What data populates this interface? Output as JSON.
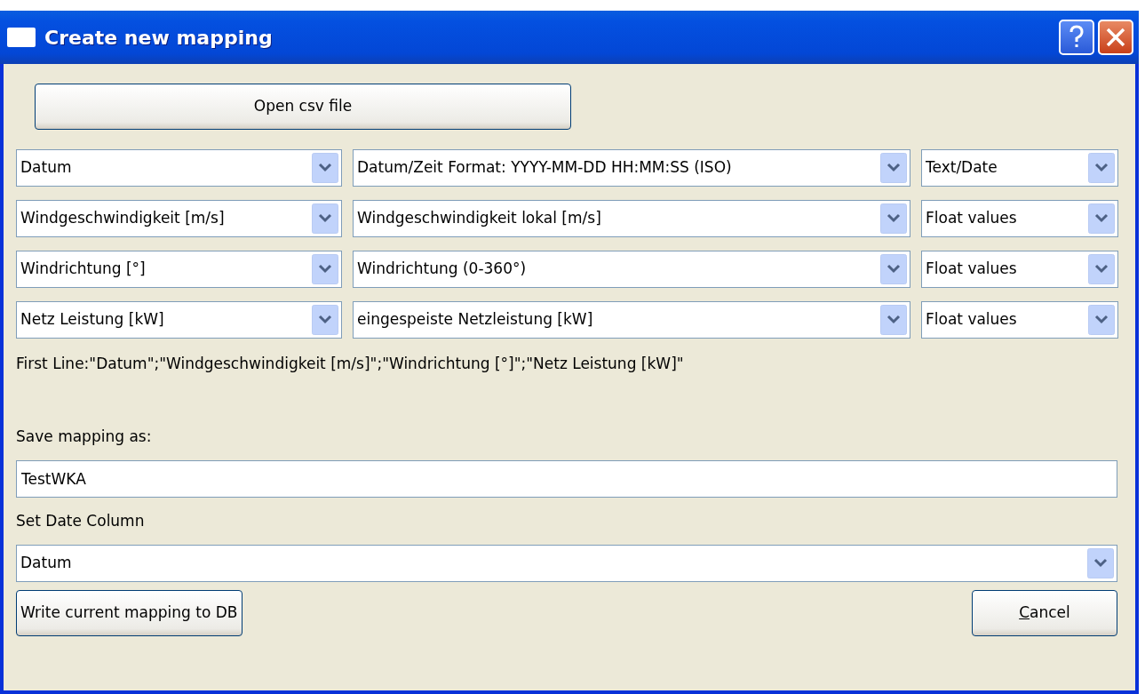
{
  "window": {
    "title": "Create new mapping"
  },
  "open_button": {
    "label": "Open csv file"
  },
  "mappings": [
    {
      "source": "Datum",
      "target": "Datum/Zeit Format: YYYY-MM-DD HH:MM:SS (ISO)",
      "type": "Text/Date"
    },
    {
      "source": "Windgeschwindigkeit [m/s]",
      "target": "Windgeschwindigkeit lokal [m/s]",
      "type": "Float values"
    },
    {
      "source": "Windrichtung [°]",
      "target": "Windrichtung (0-360°)",
      "type": "Float values"
    },
    {
      "source": "Netz Leistung [kW]",
      "target": "eingespeiste Netzleistung [kW]",
      "type": "Float values"
    }
  ],
  "first_line": "First Line:\"Datum\";\"Windgeschwindigkeit [m/s]\";\"Windrichtung [°]\";\"Netz Leistung [kW]\"",
  "save_label": "Save mapping as:",
  "save_field": {
    "value": "TestWKA"
  },
  "date_label": "Set Date Column",
  "date_select": {
    "value": "Datum"
  },
  "buttons": [
    {
      "label": "Write current mapping to DB",
      "mnemonic": false
    },
    {
      "label": "Cancel",
      "mnemonic": true
    }
  ]
}
